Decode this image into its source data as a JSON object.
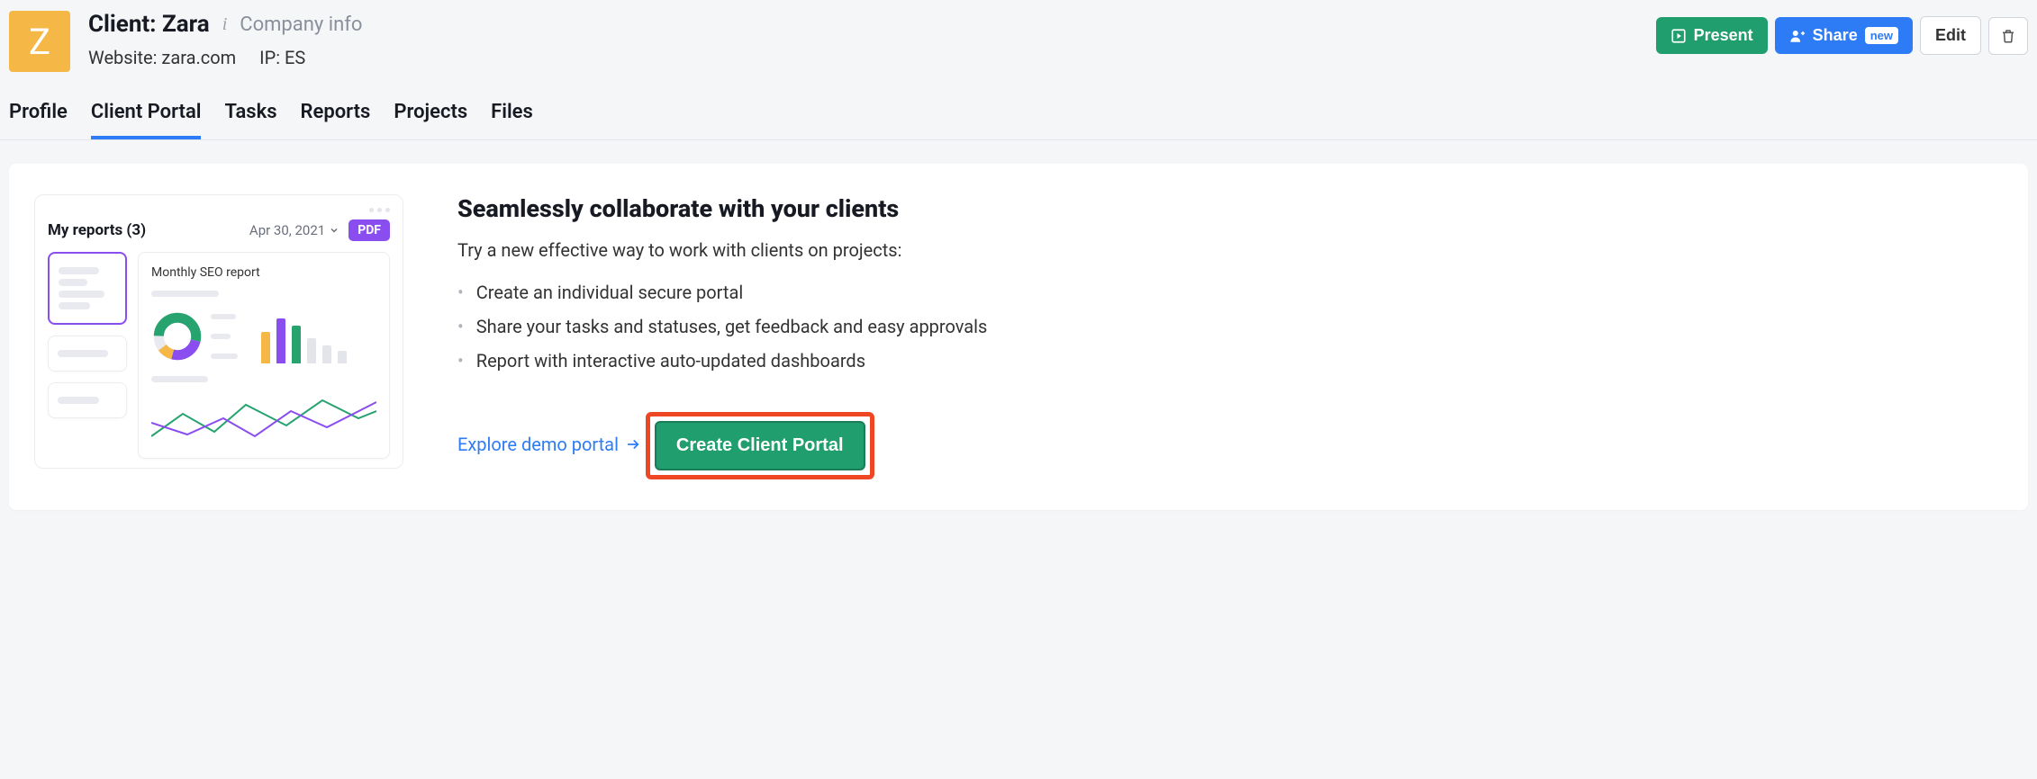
{
  "header": {
    "avatar_letter": "Z",
    "title": "Client: Zara",
    "company_info_label": "Company info",
    "website_label": "Website: zara.com",
    "ip_label": "IP: ES"
  },
  "actions": {
    "present": "Present",
    "share": "Share",
    "share_badge": "new",
    "edit": "Edit"
  },
  "tabs": [
    {
      "label": "Profile",
      "active": false
    },
    {
      "label": "Client Portal",
      "active": true
    },
    {
      "label": "Tasks",
      "active": false
    },
    {
      "label": "Reports",
      "active": false
    },
    {
      "label": "Projects",
      "active": false
    },
    {
      "label": "Files",
      "active": false
    }
  ],
  "mock": {
    "reports_title": "My reports (3)",
    "date": "Apr 30, 2021",
    "pdf": "PDF",
    "report_title": "Monthly SEO report"
  },
  "content": {
    "heading": "Seamlessly collaborate with your clients",
    "intro": "Try a new effective way to work with clients on projects:",
    "bullets": [
      "Create an individual secure portal",
      "Share your tasks and statuses, get feedback and easy approvals",
      "Report with interactive auto-updated dashboards"
    ],
    "explore": "Explore demo portal",
    "create": "Create Client Portal"
  }
}
